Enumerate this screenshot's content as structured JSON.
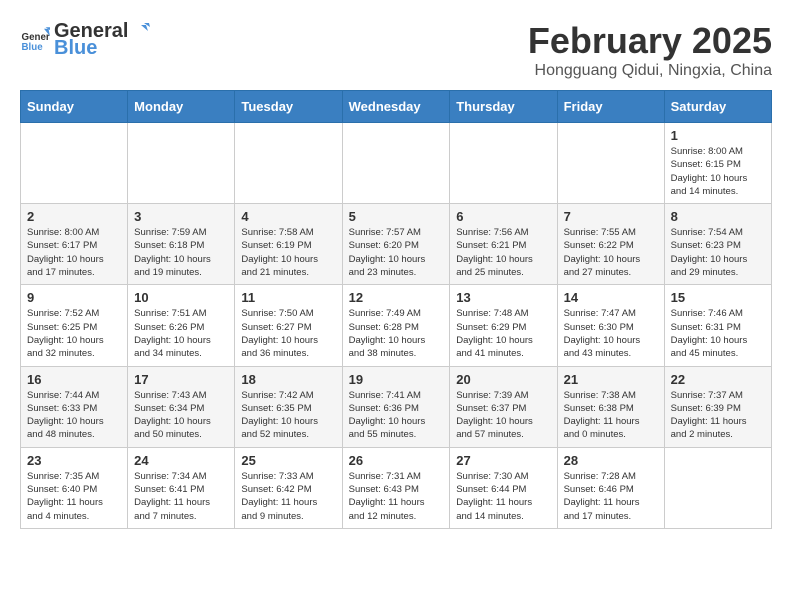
{
  "header": {
    "logo_general": "General",
    "logo_blue": "Blue",
    "month_title": "February 2025",
    "location": "Hongguang Qidui, Ningxia, China"
  },
  "weekdays": [
    "Sunday",
    "Monday",
    "Tuesday",
    "Wednesday",
    "Thursday",
    "Friday",
    "Saturday"
  ],
  "weeks": [
    [
      {
        "day": "",
        "info": ""
      },
      {
        "day": "",
        "info": ""
      },
      {
        "day": "",
        "info": ""
      },
      {
        "day": "",
        "info": ""
      },
      {
        "day": "",
        "info": ""
      },
      {
        "day": "",
        "info": ""
      },
      {
        "day": "1",
        "info": "Sunrise: 8:00 AM\nSunset: 6:15 PM\nDaylight: 10 hours\nand 14 minutes."
      }
    ],
    [
      {
        "day": "2",
        "info": "Sunrise: 8:00 AM\nSunset: 6:17 PM\nDaylight: 10 hours\nand 17 minutes."
      },
      {
        "day": "3",
        "info": "Sunrise: 7:59 AM\nSunset: 6:18 PM\nDaylight: 10 hours\nand 19 minutes."
      },
      {
        "day": "4",
        "info": "Sunrise: 7:58 AM\nSunset: 6:19 PM\nDaylight: 10 hours\nand 21 minutes."
      },
      {
        "day": "5",
        "info": "Sunrise: 7:57 AM\nSunset: 6:20 PM\nDaylight: 10 hours\nand 23 minutes."
      },
      {
        "day": "6",
        "info": "Sunrise: 7:56 AM\nSunset: 6:21 PM\nDaylight: 10 hours\nand 25 minutes."
      },
      {
        "day": "7",
        "info": "Sunrise: 7:55 AM\nSunset: 6:22 PM\nDaylight: 10 hours\nand 27 minutes."
      },
      {
        "day": "8",
        "info": "Sunrise: 7:54 AM\nSunset: 6:23 PM\nDaylight: 10 hours\nand 29 minutes."
      }
    ],
    [
      {
        "day": "9",
        "info": "Sunrise: 7:52 AM\nSunset: 6:25 PM\nDaylight: 10 hours\nand 32 minutes."
      },
      {
        "day": "10",
        "info": "Sunrise: 7:51 AM\nSunset: 6:26 PM\nDaylight: 10 hours\nand 34 minutes."
      },
      {
        "day": "11",
        "info": "Sunrise: 7:50 AM\nSunset: 6:27 PM\nDaylight: 10 hours\nand 36 minutes."
      },
      {
        "day": "12",
        "info": "Sunrise: 7:49 AM\nSunset: 6:28 PM\nDaylight: 10 hours\nand 38 minutes."
      },
      {
        "day": "13",
        "info": "Sunrise: 7:48 AM\nSunset: 6:29 PM\nDaylight: 10 hours\nand 41 minutes."
      },
      {
        "day": "14",
        "info": "Sunrise: 7:47 AM\nSunset: 6:30 PM\nDaylight: 10 hours\nand 43 minutes."
      },
      {
        "day": "15",
        "info": "Sunrise: 7:46 AM\nSunset: 6:31 PM\nDaylight: 10 hours\nand 45 minutes."
      }
    ],
    [
      {
        "day": "16",
        "info": "Sunrise: 7:44 AM\nSunset: 6:33 PM\nDaylight: 10 hours\nand 48 minutes."
      },
      {
        "day": "17",
        "info": "Sunrise: 7:43 AM\nSunset: 6:34 PM\nDaylight: 10 hours\nand 50 minutes."
      },
      {
        "day": "18",
        "info": "Sunrise: 7:42 AM\nSunset: 6:35 PM\nDaylight: 10 hours\nand 52 minutes."
      },
      {
        "day": "19",
        "info": "Sunrise: 7:41 AM\nSunset: 6:36 PM\nDaylight: 10 hours\nand 55 minutes."
      },
      {
        "day": "20",
        "info": "Sunrise: 7:39 AM\nSunset: 6:37 PM\nDaylight: 10 hours\nand 57 minutes."
      },
      {
        "day": "21",
        "info": "Sunrise: 7:38 AM\nSunset: 6:38 PM\nDaylight: 11 hours\nand 0 minutes."
      },
      {
        "day": "22",
        "info": "Sunrise: 7:37 AM\nSunset: 6:39 PM\nDaylight: 11 hours\nand 2 minutes."
      }
    ],
    [
      {
        "day": "23",
        "info": "Sunrise: 7:35 AM\nSunset: 6:40 PM\nDaylight: 11 hours\nand 4 minutes."
      },
      {
        "day": "24",
        "info": "Sunrise: 7:34 AM\nSunset: 6:41 PM\nDaylight: 11 hours\nand 7 minutes."
      },
      {
        "day": "25",
        "info": "Sunrise: 7:33 AM\nSunset: 6:42 PM\nDaylight: 11 hours\nand 9 minutes."
      },
      {
        "day": "26",
        "info": "Sunrise: 7:31 AM\nSunset: 6:43 PM\nDaylight: 11 hours\nand 12 minutes."
      },
      {
        "day": "27",
        "info": "Sunrise: 7:30 AM\nSunset: 6:44 PM\nDaylight: 11 hours\nand 14 minutes."
      },
      {
        "day": "28",
        "info": "Sunrise: 7:28 AM\nSunset: 6:46 PM\nDaylight: 11 hours\nand 17 minutes."
      },
      {
        "day": "",
        "info": ""
      }
    ]
  ]
}
